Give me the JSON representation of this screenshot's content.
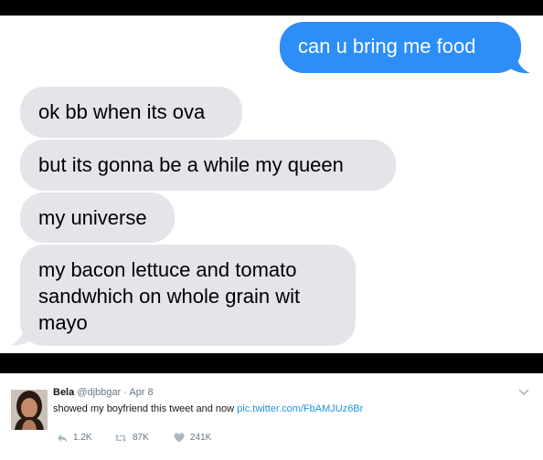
{
  "messages": {
    "sent_1": "can u bring me food",
    "received_1": "ok bb when its ova",
    "received_2": "but its gonna be a while my queen",
    "received_3": "my universe",
    "received_4_line1": "my bacon lettuce and tomato",
    "received_4_line2": "sandwhich on whole grain wit",
    "received_4_line3": "mayo"
  },
  "tweet": {
    "name": "Bela",
    "handle": "@djbbgar",
    "separator": "·",
    "date": "Apr 8",
    "text": "showed my boyfriend this tweet and now",
    "link": "pic.twitter.com/FbAMJUz6Br",
    "reply_count": "1.2K",
    "retweet_count": "87K",
    "like_count": "241K"
  },
  "colors": {
    "sent_bubble": "#2d8ef8",
    "received_bubble": "#e4e4e9",
    "link": "#1b95e0"
  }
}
